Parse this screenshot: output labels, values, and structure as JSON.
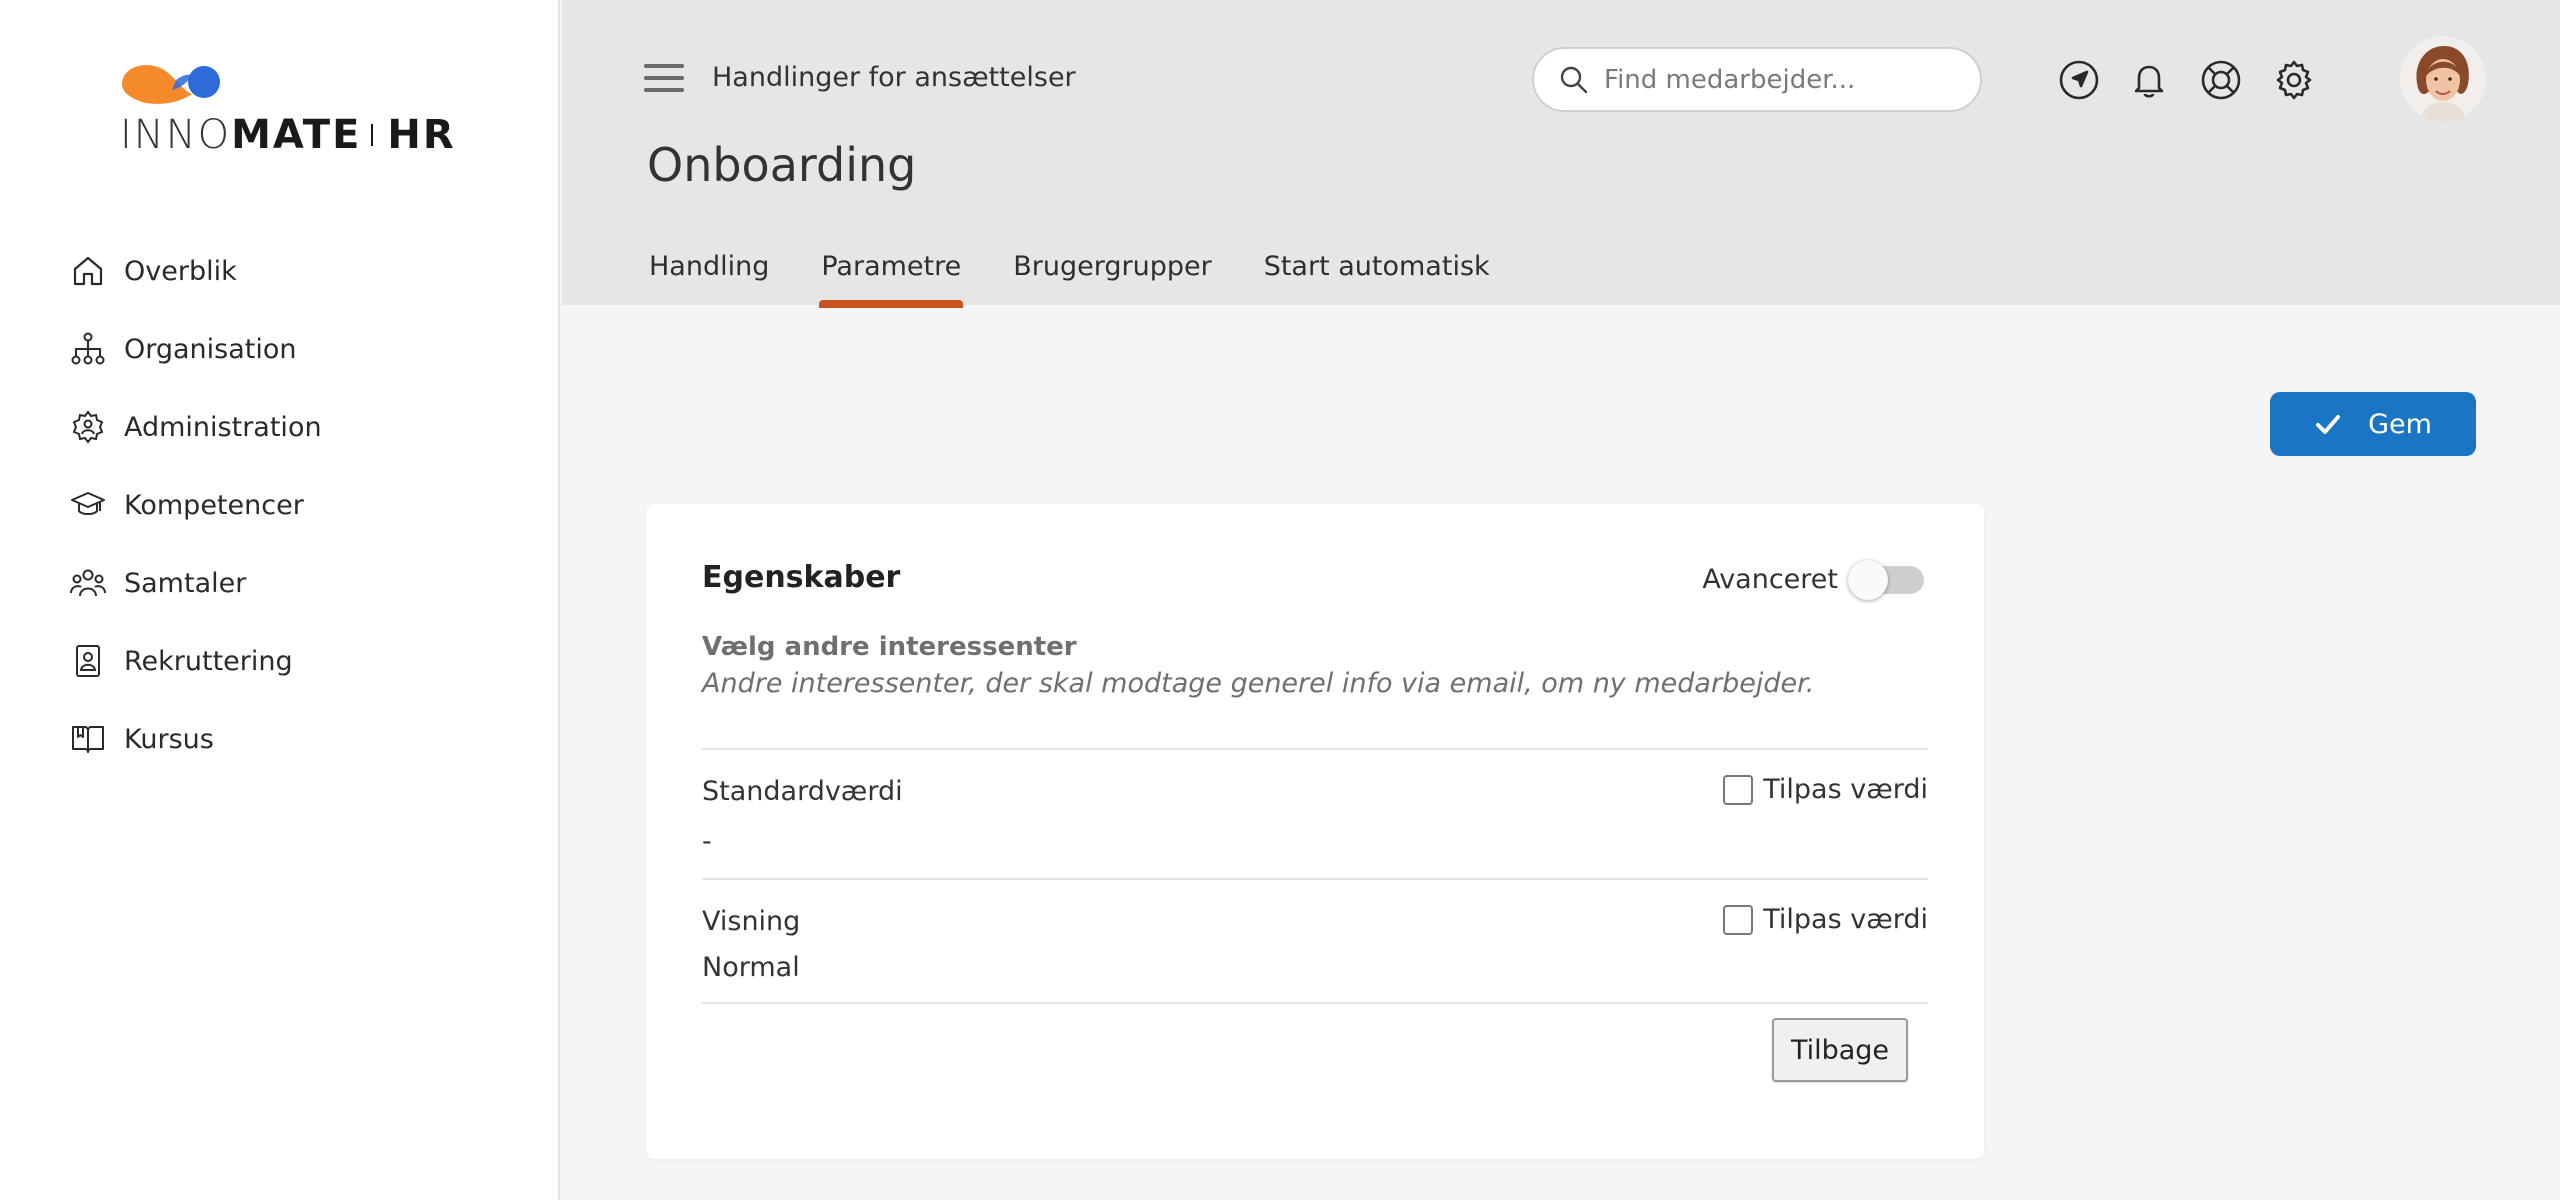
{
  "brand": {
    "name_part1": "INNO",
    "name_part2": "MATE",
    "name_part3": "HR",
    "colors": {
      "orange": "#f58a2a",
      "blue": "#2f6bd8"
    }
  },
  "sidebar": {
    "items": [
      {
        "label": "Overblik",
        "icon": "home-icon"
      },
      {
        "label": "Organisation",
        "icon": "org-chart-icon"
      },
      {
        "label": "Administration",
        "icon": "gear-person-icon"
      },
      {
        "label": "Kompetencer",
        "icon": "graduation-cap-icon"
      },
      {
        "label": "Samtaler",
        "icon": "group-icon"
      },
      {
        "label": "Rekruttering",
        "icon": "id-badge-icon"
      },
      {
        "label": "Kursus",
        "icon": "book-icon"
      }
    ]
  },
  "header": {
    "breadcrumb": "Handlinger for ansættelser",
    "title": "Onboarding",
    "search_placeholder": "Find medarbejder...",
    "icons": [
      "navigation-icon",
      "bell-icon",
      "lifebuoy-icon",
      "gear-icon"
    ],
    "tabs": [
      {
        "label": "Handling",
        "active": false
      },
      {
        "label": "Parametre",
        "active": true
      },
      {
        "label": "Brugergrupper",
        "active": false
      },
      {
        "label": "Start automatisk",
        "active": false
      }
    ],
    "accent_color": "#c9521f"
  },
  "toolbar": {
    "save_label": "Gem",
    "save_color": "#1a76c4"
  },
  "card": {
    "title": "Egenskaber",
    "advanced_label": "Avanceret",
    "advanced_on": false,
    "subtitle": "Vælg andre interessenter",
    "description": "Andre interessenter, der skal modtage generel info via email, om ny medarbejder.",
    "rows": [
      {
        "label": "Standardværdi",
        "value": "-",
        "checkbox_label": "Tilpas værdi",
        "checked": false
      },
      {
        "label": "Visning",
        "value": "Normal",
        "checkbox_label": "Tilpas værdi",
        "checked": false
      }
    ],
    "back_label": "Tilbage"
  }
}
